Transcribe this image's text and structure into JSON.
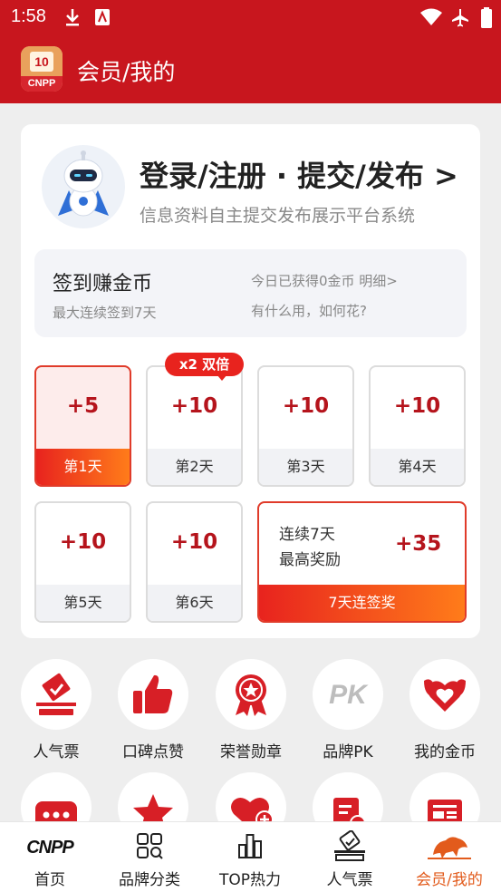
{
  "status_bar": {
    "time": "1:58"
  },
  "app_bar": {
    "title": "会员/我的",
    "logo_number": "10",
    "logo_text": "CNPP"
  },
  "profile": {
    "login_title": "登录/注册 · 提交/发布 >",
    "subtitle": "信息资料自主提交发布展示平台系统"
  },
  "sign_in": {
    "title": "签到赚金币",
    "max_streak": "最大连续签到7天",
    "today_earned": "今日已获得0金币 明细>",
    "help": "有什么用，如何花?",
    "double_badge": "x2 双倍",
    "days": [
      {
        "points": "+5",
        "label": "第1天",
        "active": true
      },
      {
        "points": "+10",
        "label": "第2天",
        "active": false
      },
      {
        "points": "+10",
        "label": "第3天",
        "active": false
      },
      {
        "points": "+10",
        "label": "第4天",
        "active": false
      },
      {
        "points": "+10",
        "label": "第5天",
        "active": false
      },
      {
        "points": "+10",
        "label": "第6天",
        "active": false
      }
    ],
    "bonus": {
      "line1": "连续7天",
      "line2": "最高奖励",
      "points": "+35",
      "label": "7天连签奖"
    }
  },
  "features": [
    {
      "label": "人气票",
      "icon": "ballot-box-icon"
    },
    {
      "label": "口碑点赞",
      "icon": "thumbs-up-icon"
    },
    {
      "label": "荣誉勋章",
      "icon": "medal-icon"
    },
    {
      "label": "品牌PK",
      "icon": "pk-icon"
    },
    {
      "label": "我的金币",
      "icon": "heart-coin-icon"
    }
  ],
  "features_row2_icons": [
    "chat-bubble-icon",
    "star-icon",
    "heart-plus-icon",
    "document-clock-icon",
    "newspaper-icon"
  ],
  "pk_text": "PK",
  "tab_bar": {
    "logo_text": "CNPP",
    "items": [
      {
        "label": "首页"
      },
      {
        "label": "品牌分类"
      },
      {
        "label": "TOP热力"
      },
      {
        "label": "人气票"
      },
      {
        "label": "会员/我的"
      }
    ]
  },
  "colors": {
    "brand_red": "#c8161e",
    "accent_orange": "#e25b1c",
    "points_red": "#b5141c"
  }
}
